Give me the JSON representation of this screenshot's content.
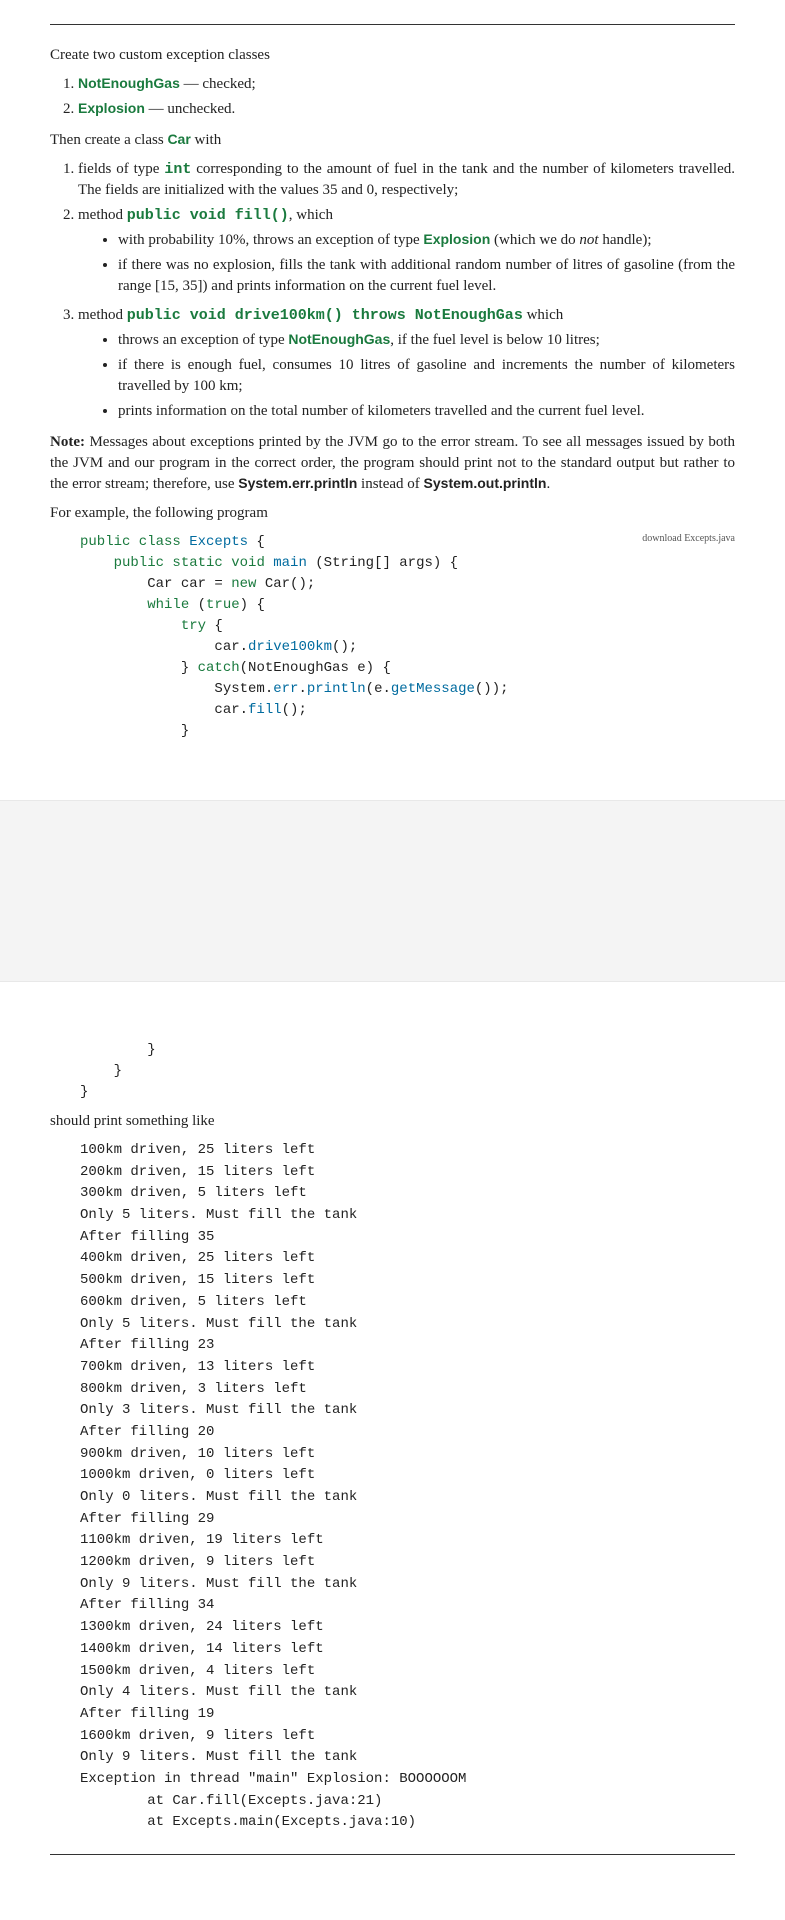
{
  "intro": "Create two custom exception classes",
  "list1": {
    "i1_a": "NotEnoughGas",
    "i1_b": " — checked;",
    "i2_a": "Explosion",
    "i2_b": " — unchecked."
  },
  "then_a": "Then create a class ",
  "then_b": "Car",
  "then_c": " with",
  "list2": {
    "i1_a": "fields of type ",
    "i1_b": "int",
    "i1_c": " corresponding to the amount of fuel in the tank and the number of kilometers travelled. The fields are initialized with the values 35 and 0, respectively;",
    "i2_a": "method ",
    "i2_b": "public void fill()",
    "i2_c": ", which",
    "i2_bul": {
      "b1_a": "with probability 10%, throws an exception of type ",
      "b1_b": "Explosion",
      "b1_c": " (which we do ",
      "b1_d": "not",
      "b1_e": " handle);",
      "b2": "if there was no explosion, fills the tank with additional random number of litres of gasoline (from the range [15, 35]) and prints information on the current fuel level."
    },
    "i3_a": "method ",
    "i3_b": "public void drive100km() throws NotEnoughGas",
    "i3_c": " which",
    "i3_bul": {
      "b1_a": "throws an exception of type ",
      "b1_b": "NotEnoughGas",
      "b1_c": ", if the fuel level is below 10 litres;",
      "b2": "if there is enough fuel, consumes 10 litres of gasoline and increments the number of kilometers travelled by 100 km;",
      "b3": "prints information on the total number of kilometers travelled and the current fuel level."
    }
  },
  "note": {
    "lbl": "Note:",
    "a": " Messages about exceptions printed by the JVM go to the error stream. To see all messages issued by both the JVM and our program in the correct order, the program should print not to the standard output but rather to the error stream; therefore, use ",
    "b": "System.err.println",
    "c": " instead of ",
    "d": "System.out.println",
    "e": "."
  },
  "for_example": "For example, the following program",
  "download": "download Excepts.java",
  "code": {
    "l1a": "public class ",
    "l1b": "Excepts",
    "l1c": " {",
    "l2a": "    public static ",
    "l2b": "void",
    "l2c": " main",
    "l2d": " (String[] args) {",
    "l3a": "        Car car = ",
    "l3b": "new",
    "l3c": " Car();",
    "l4a": "        while",
    "l4b": " (",
    "l4c": "true",
    "l4d": ") {",
    "l5a": "            try",
    "l5b": " {",
    "l6a": "                car.",
    "l6b": "drive100km",
    "l6c": "();",
    "l7a": "            } ",
    "l7b": "catch",
    "l7c": "(NotEnoughGas e) {",
    "l8a": "                System.",
    "l8b": "err",
    "l8c": ".",
    "l8d": "println",
    "l8e": "(e.",
    "l8f": "getMessage",
    "l8g": "());",
    "l9a": "                car.",
    "l9b": "fill",
    "l9c": "();",
    "l10": "            }",
    "l11": "        }",
    "l12": "    }",
    "l13": "}"
  },
  "should_print": "should print something like",
  "output": "100km driven, 25 liters left\n200km driven, 15 liters left\n300km driven, 5 liters left\nOnly 5 liters. Must fill the tank\nAfter filling 35\n400km driven, 25 liters left\n500km driven, 15 liters left\n600km driven, 5 liters left\nOnly 5 liters. Must fill the tank\nAfter filling 23\n700km driven, 13 liters left\n800km driven, 3 liters left\nOnly 3 liters. Must fill the tank\nAfter filling 20\n900km driven, 10 liters left\n1000km driven, 0 liters left\nOnly 0 liters. Must fill the tank\nAfter filling 29\n1100km driven, 19 liters left\n1200km driven, 9 liters left\nOnly 9 liters. Must fill the tank\nAfter filling 34\n1300km driven, 24 liters left\n1400km driven, 14 liters left\n1500km driven, 4 liters left\nOnly 4 liters. Must fill the tank\nAfter filling 19\n1600km driven, 9 liters left\nOnly 9 liters. Must fill the tank\nException in thread \"main\" Explosion: BOOOOOOM\n        at Car.fill(Excepts.java:21)\n        at Excepts.main(Excepts.java:10)"
}
